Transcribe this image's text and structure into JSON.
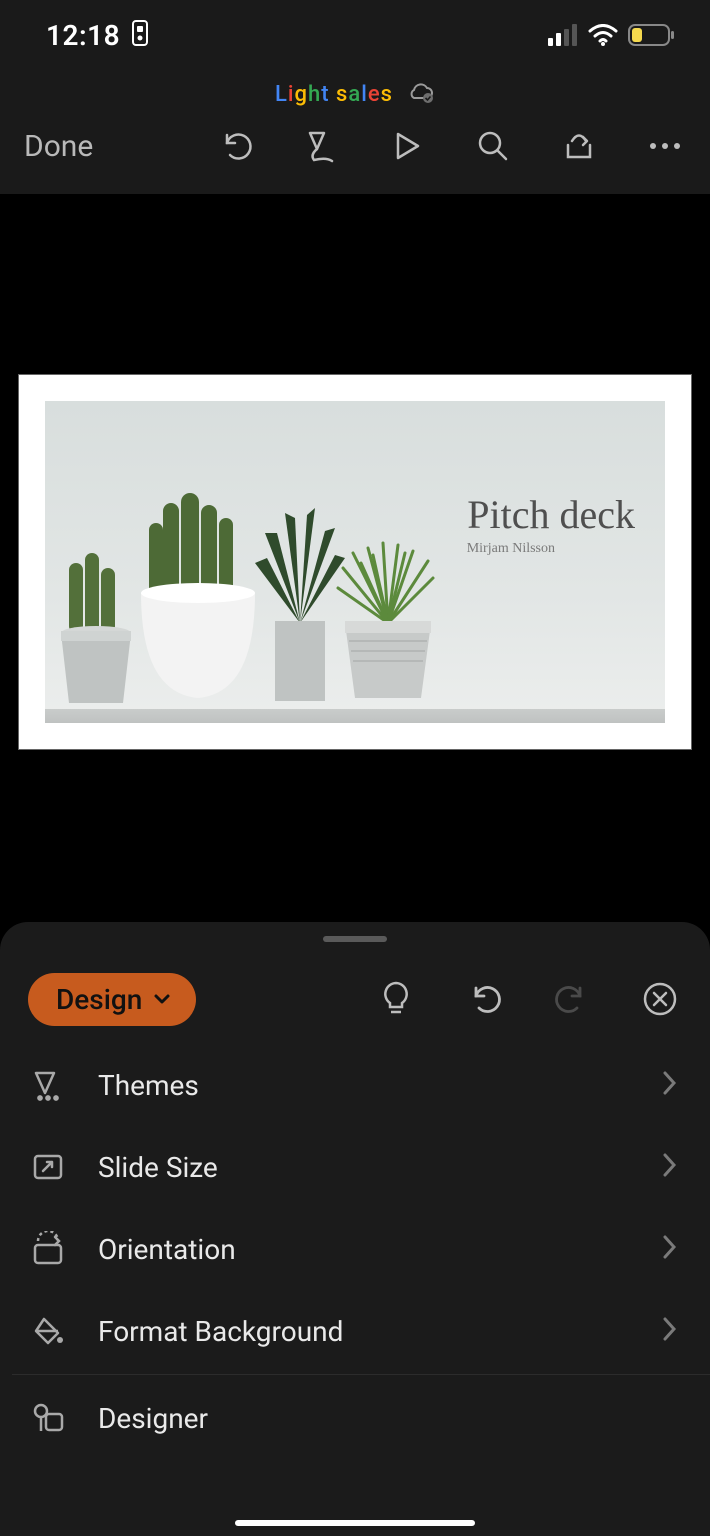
{
  "status": {
    "time": "12:18"
  },
  "header": {
    "doc_title": "Light sales",
    "done_label": "Done"
  },
  "slide": {
    "title": "Pitch deck",
    "subtitle": "Mirjam Nilsson"
  },
  "sheet": {
    "chip_label": "Design",
    "items": [
      {
        "label": "Themes"
      },
      {
        "label": "Slide Size"
      },
      {
        "label": "Orientation"
      },
      {
        "label": "Format Background"
      },
      {
        "label": "Designer"
      }
    ]
  },
  "colors": {
    "accent": "#c75b1e"
  }
}
